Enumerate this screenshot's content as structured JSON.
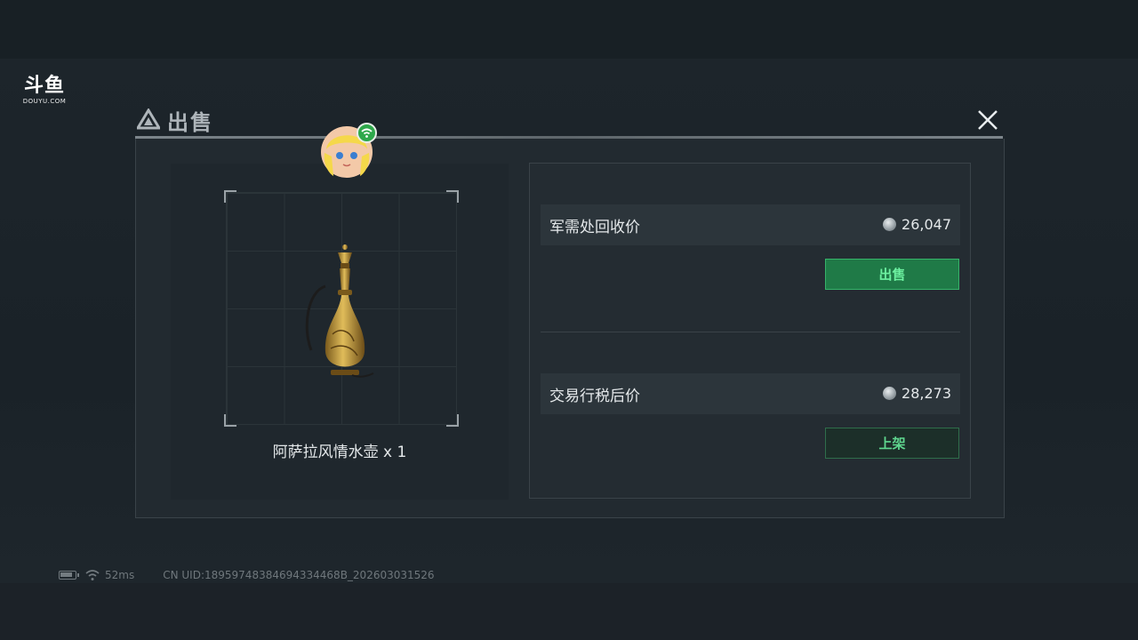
{
  "watermark": {
    "title": "斗鱼",
    "subtitle": "DOUYU.COM"
  },
  "dialog": {
    "title": "出售"
  },
  "item": {
    "caption": "阿萨拉风情水壶 x 1"
  },
  "prices": {
    "recycle": {
      "label": "军需处回收价",
      "value": "26,047",
      "button": "出售"
    },
    "trade": {
      "label": "交易行税后价",
      "value": "28,273",
      "button": "上架"
    }
  },
  "status": {
    "latency": "52ms",
    "uid": "CN UID:18959748384694334468B_202603031526"
  },
  "colors": {
    "accent_green": "#1f7a47",
    "accent_text": "#6cf0a0",
    "panel": "#242c32"
  },
  "icons": [
    "douyu-logo",
    "triangle-logo-icon",
    "close-icon",
    "coin-icon",
    "wifi-icon",
    "battery-icon",
    "player-avatar",
    "ornate-pitcher-item"
  ]
}
